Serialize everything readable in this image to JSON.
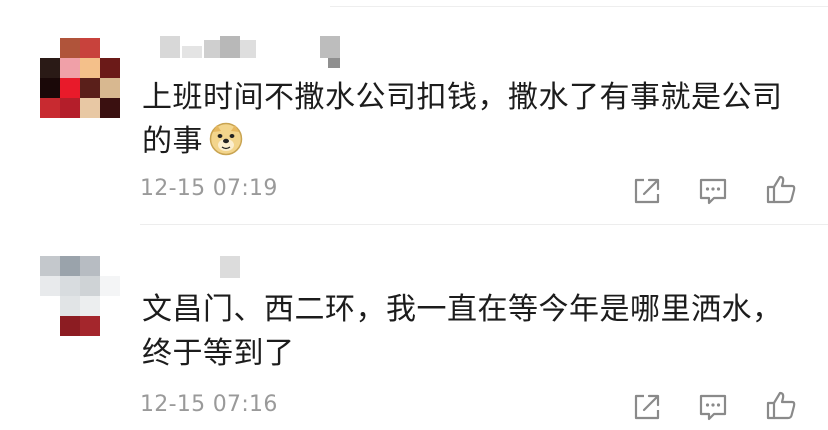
{
  "comments": [
    {
      "text_line1": "上班时间不撒水公司扣钱，撒水了有事就是公司",
      "text_line2": "的事",
      "emoji": "doge-emoji",
      "timestamp": "12-15 07:19"
    },
    {
      "text_line1": "文昌门、西二环，我一直在等今年是哪里洒水，",
      "text_line2": "终于等到了",
      "timestamp": "12-15 07:16"
    }
  ],
  "icons": {
    "share": "share-icon",
    "reply": "comment-icon",
    "like": "thumbs-up-icon"
  },
  "colors": {
    "text": "#1c1c1c",
    "timestamp": "#9a9a9a",
    "icon": "#8a8a8a"
  }
}
